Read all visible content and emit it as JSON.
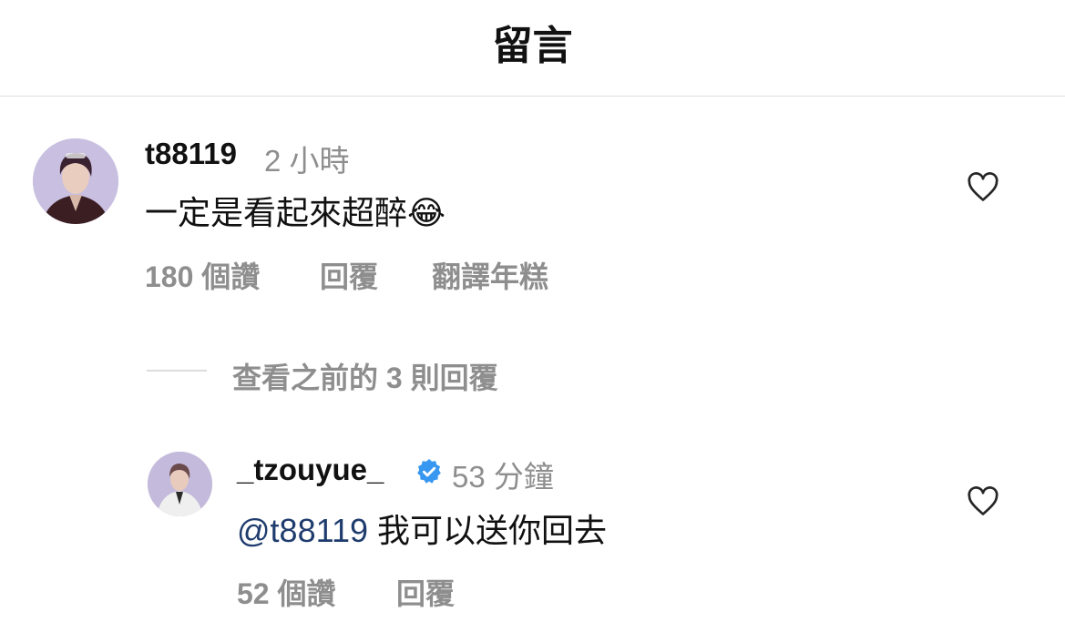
{
  "header": {
    "title": "留言"
  },
  "comment": {
    "username": "t88119",
    "time": "2 小時",
    "text": "一定是看起來超醉",
    "emoji": "😂",
    "likes": "180 個讚",
    "reply": "回覆",
    "translate": "翻譯年糕"
  },
  "view_replies": {
    "label": "查看之前的 3 則回覆"
  },
  "reply": {
    "username": "_tzouyue_",
    "time": "53 分鐘",
    "mention": "@t88119",
    "text": "我可以送你回去",
    "likes": "52 個讚",
    "reply": "回覆"
  },
  "colors": {
    "mention": "#1f3c6e",
    "verified": "#3897f0",
    "muted": "#8e8e8e"
  }
}
